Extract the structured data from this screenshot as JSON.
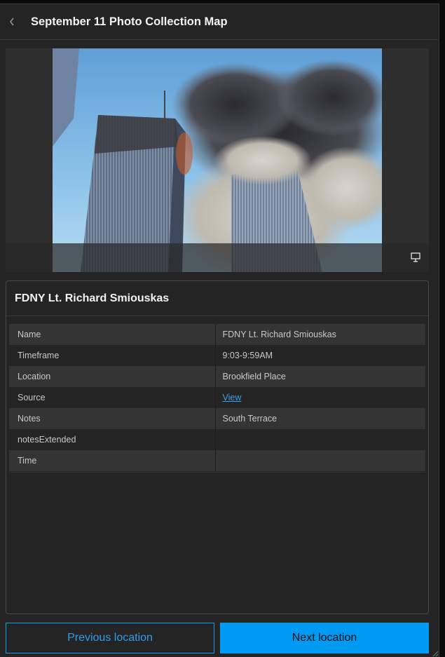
{
  "header": {
    "back_icon": "chevron-left-icon",
    "title": "September 11 Photo Collection Map"
  },
  "media": {
    "fullscreen_icon": "presentation-screen-icon"
  },
  "card": {
    "title": "FDNY Lt. Richard Smiouskas",
    "rows": [
      {
        "key": "Name",
        "value": "FDNY Lt. Richard Smiouskas"
      },
      {
        "key": "Timeframe",
        "value": "9:03-9:59AM"
      },
      {
        "key": "Location",
        "value": "Brookfield Place"
      },
      {
        "key": "Source",
        "value": "View"
      },
      {
        "key": "Notes",
        "value": "South Terrace"
      },
      {
        "key": "notesExtended",
        "value": ""
      },
      {
        "key": "Time",
        "value": ""
      }
    ]
  },
  "footer": {
    "prev_label": "Previous location",
    "next_label": "Next location"
  },
  "colors": {
    "accent": "#009af2",
    "panel_bg": "#242424",
    "link": "#3aa0e8"
  }
}
